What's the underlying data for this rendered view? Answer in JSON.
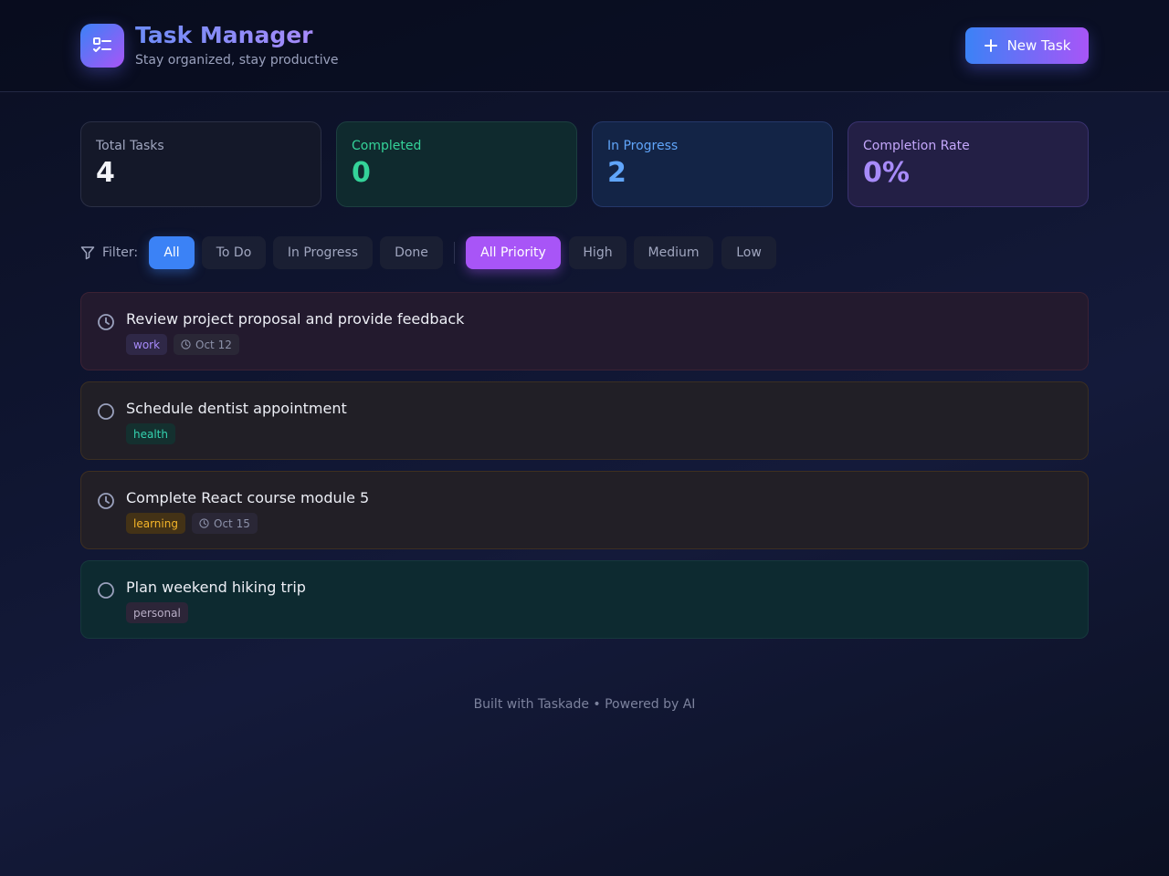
{
  "header": {
    "title": "Task Manager",
    "subtitle": "Stay organized, stay productive",
    "new_task_label": "New Task"
  },
  "stats": [
    {
      "label": "Total Tasks",
      "value": "4"
    },
    {
      "label": "Completed",
      "value": "0"
    },
    {
      "label": "In Progress",
      "value": "2"
    },
    {
      "label": "Completion Rate",
      "value": "0%"
    }
  ],
  "filters": {
    "label": "Filter:",
    "status": [
      "All",
      "To Do",
      "In Progress",
      "Done"
    ],
    "status_selected": "All",
    "priority": [
      "All Priority",
      "High",
      "Medium",
      "Low"
    ],
    "priority_selected": "All Priority"
  },
  "tasks": [
    {
      "title": "Review project proposal and provide feedback",
      "status_icon": "clock-icon",
      "tag": "work",
      "date": "Oct 12"
    },
    {
      "title": "Schedule dentist appointment",
      "status_icon": "circle-icon",
      "tag": "health"
    },
    {
      "title": "Complete React course module 5",
      "status_icon": "clock-icon",
      "tag": "learning",
      "date": "Oct 15"
    },
    {
      "title": "Plan weekend hiking trip",
      "status_icon": "circle-icon",
      "tag": "personal"
    }
  ],
  "footer": {
    "text": "Built with Taskade • Powered by AI"
  },
  "colors": {
    "accent_blue": "#3b82f6",
    "accent_purple": "#a855f7",
    "completed_green": "#34d399",
    "progress_blue": "#60a5fa",
    "rate_purple": "#a78bfa"
  }
}
